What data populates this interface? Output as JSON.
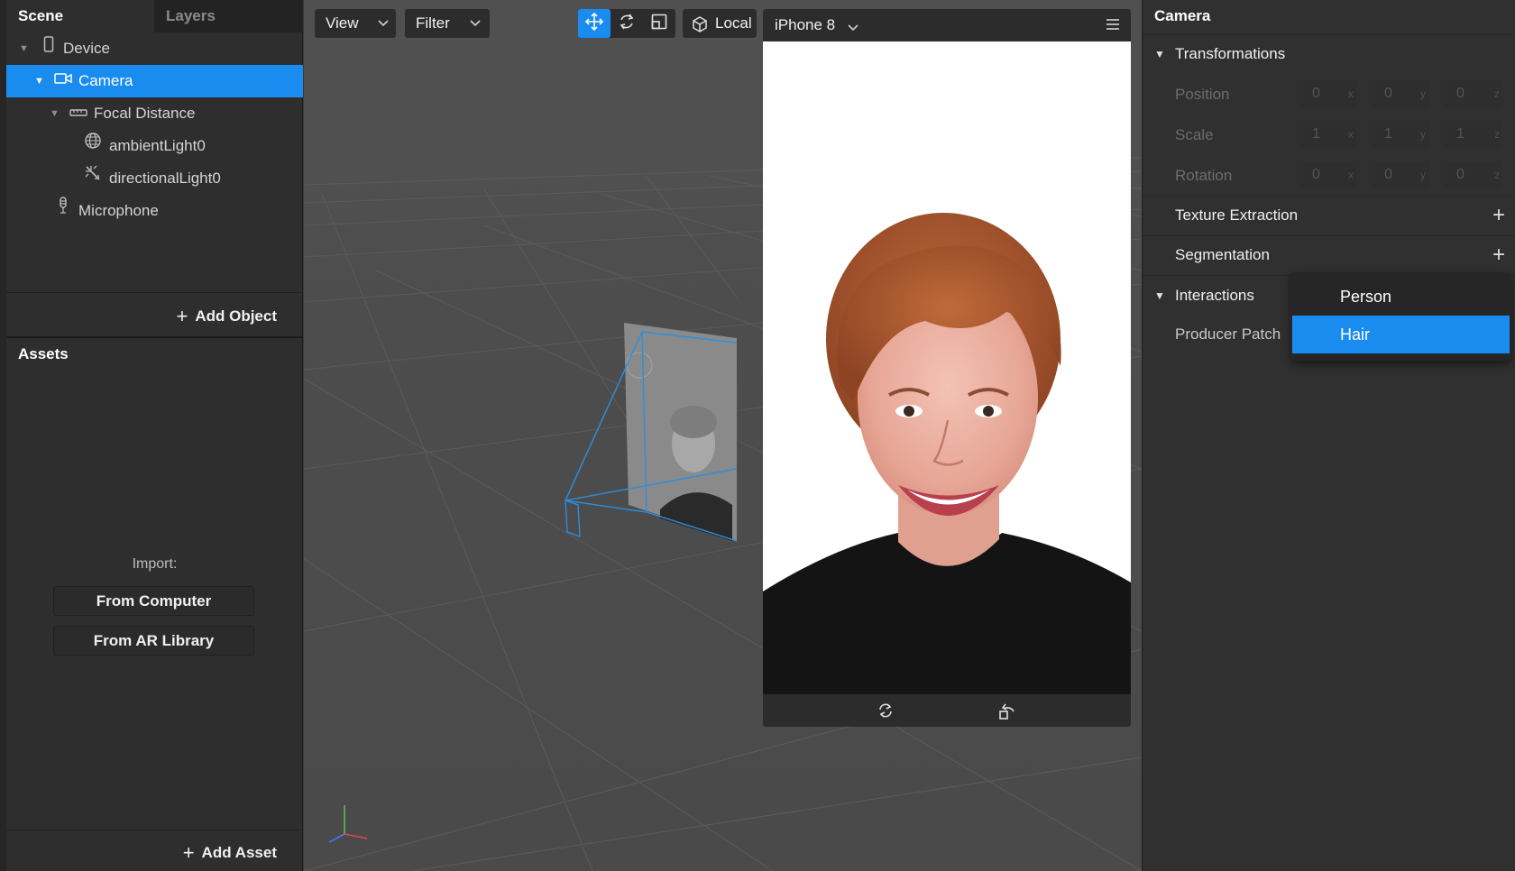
{
  "scene_panel": {
    "tabs": [
      "Scene",
      "Layers"
    ],
    "tree": [
      {
        "label": "Device",
        "icon": "phone-icon"
      },
      {
        "label": "Camera",
        "icon": "camera-icon"
      },
      {
        "label": "Focal Distance",
        "icon": "ruler-icon"
      },
      {
        "label": "ambientLight0",
        "icon": "globe-icon"
      },
      {
        "label": "directionalLight0",
        "icon": "directional-light-icon"
      },
      {
        "label": "Microphone",
        "icon": "microphone-icon"
      }
    ],
    "add_object": "Add Object"
  },
  "assets_panel": {
    "title": "Assets",
    "import_label": "Import:",
    "from_computer": "From Computer",
    "from_ar_library": "From AR Library",
    "add_asset": "Add Asset"
  },
  "viewport": {
    "view_label": "View",
    "filter_label": "Filter",
    "local_label": "Local",
    "device_label": "iPhone 8"
  },
  "inspector": {
    "title": "Camera",
    "transformations": "Transformations",
    "position_label": "Position",
    "scale_label": "Scale",
    "rotation_label": "Rotation",
    "position": [
      "0",
      "0",
      "0"
    ],
    "scale": [
      "1",
      "1",
      "1"
    ],
    "rotation": [
      "0",
      "0",
      "0"
    ],
    "axes": [
      "x",
      "y",
      "z"
    ],
    "texture_extraction": "Texture Extraction",
    "segmentation": "Segmentation",
    "interactions": "Interactions",
    "producer_patch": "Producer Patch"
  },
  "segmentation_menu": {
    "options": [
      "Person",
      "Hair"
    ],
    "selected": "Hair"
  },
  "colors": {
    "accent": "#1a8cf0",
    "panel": "#2e2e2e",
    "viewport": "#505050"
  }
}
